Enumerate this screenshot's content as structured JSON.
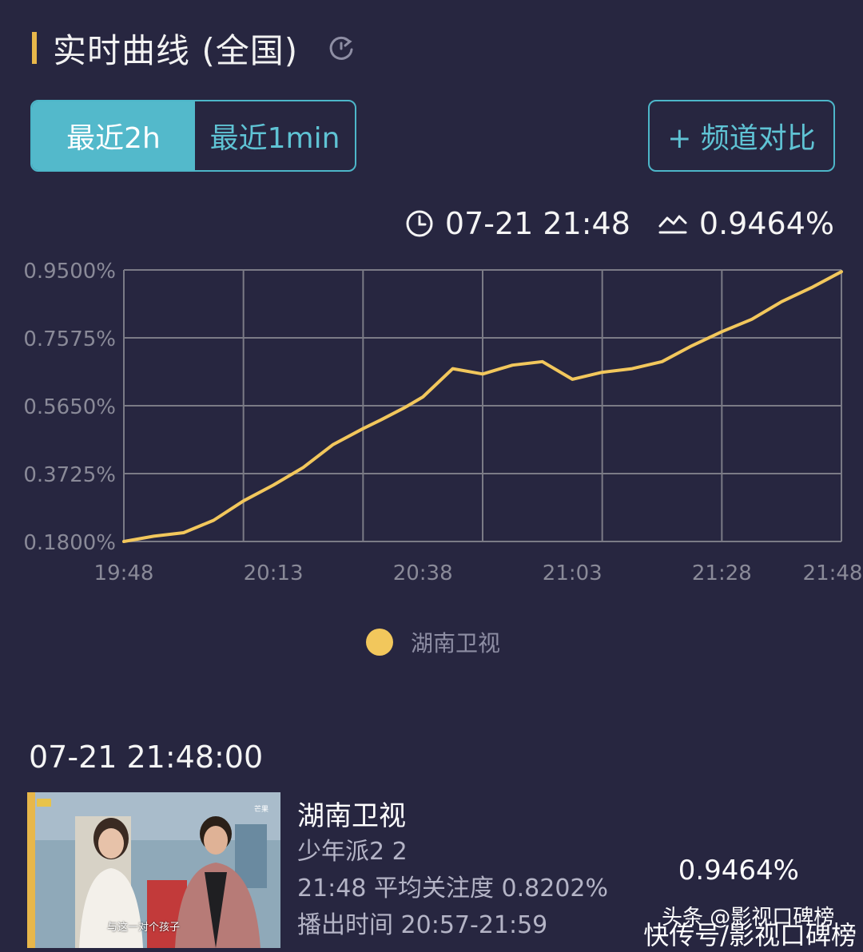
{
  "header": {
    "title": "实时曲线 (全国)",
    "refresh_icon": "refresh-icon"
  },
  "segmented": {
    "options": [
      "最近2h",
      "最近1min"
    ],
    "active": "最近2h"
  },
  "compare_button": {
    "label": "+ 频道对比"
  },
  "readout": {
    "time": "07-21 21:48",
    "value": "0.9464%",
    "time_icon": "clock-icon",
    "value_icon": "trend-icon"
  },
  "colors": {
    "background": "#272640",
    "accent": "#53b9cb",
    "line": "#f2c75c",
    "grid": "#7b7b86",
    "header_bar": "#e8b74a"
  },
  "chart_data": {
    "type": "line",
    "title": "",
    "xlabel": "",
    "ylabel": "",
    "y_ticks": [
      "0.9500%",
      "0.7575%",
      "0.5650%",
      "0.3725%",
      "0.1800%"
    ],
    "x_ticks": [
      "19:48",
      "20:13",
      "20:38",
      "21:03",
      "21:28",
      "21:48"
    ],
    "ylim": [
      0.18,
      0.95
    ],
    "grid": true,
    "legend_position": "bottom-center",
    "series": [
      {
        "name": "湖南卫视",
        "color": "#f2c75c",
        "x": [
          "19:48",
          "19:53",
          "19:58",
          "20:03",
          "20:08",
          "20:13",
          "20:18",
          "20:23",
          "20:28",
          "20:31",
          "20:35",
          "20:38",
          "20:43",
          "20:48",
          "20:51",
          "20:53",
          "20:58",
          "21:03",
          "21:08",
          "21:13",
          "21:18",
          "21:23",
          "21:28",
          "21:33",
          "21:38",
          "21:43",
          "21:48"
        ],
        "values": [
          0.18,
          0.195,
          0.205,
          0.24,
          0.295,
          0.34,
          0.39,
          0.455,
          0.5,
          0.525,
          0.56,
          0.59,
          0.67,
          0.655,
          0.67,
          0.68,
          0.69,
          0.64,
          0.66,
          0.67,
          0.69,
          0.735,
          0.775,
          0.81,
          0.86,
          0.9,
          0.945
        ]
      }
    ]
  },
  "timestamp": "07-21 21:48:00",
  "card": {
    "thumb_caption": "与这一对个孩子",
    "channel": "湖南卫视",
    "program": "少年派2 2",
    "avg": "21:48 平均关注度 0.8202%",
    "airtime": "播出时间 20:57-21:59",
    "value": "0.9464%"
  },
  "watermark": {
    "line1": "头条 @影视口碑榜",
    "line2": "快传号/影视口碑榜"
  }
}
